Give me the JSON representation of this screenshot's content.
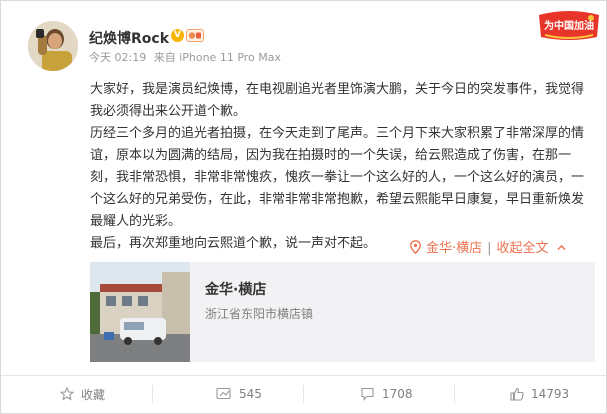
{
  "author": {
    "name": "纪焕博Rock",
    "verified_icon": "verified-v-icon",
    "level_icon": "member-level-icon"
  },
  "meta": {
    "time": "今天 02:19",
    "source": "来自 iPhone 11 Pro Max"
  },
  "promo": {
    "label": "为中国加油"
  },
  "post": {
    "paragraphs": [
      "大家好，我是演员纪焕博，在电视剧追光者里饰演大鹏，关于今日的突发事件，我觉得我必须得出来公开道个歉。",
      "历经三个多月的追光者拍摄，在今天走到了尾声。三个月下来大家积累了非常深厚的情谊，原本以为圆满的结局，因为我在拍摄时的一个失误，给云熙造成了伤害，在那一刻，我非常恐惧，非常非常愧疚，愧疚一拳让一个这么好的人，一个这么好的演员，一个这么好的兄弟受伤，在此，非常非常非常抱歉，希望云熙能早日康复，早日重新焕发最耀人的光彩。",
      "最后，再次郑重地向云熙道个歉，说一声对不起。"
    ],
    "location_label": "金华·横店",
    "expand_label": "收起全文",
    "expand_icon": "collapse-arrow-icon"
  },
  "location_card": {
    "title": "金华·横店",
    "address": "浙江省东阳市横店镇"
  },
  "actions": {
    "favorite": "收藏",
    "repost": "545",
    "comment": "1708",
    "like": "14793"
  },
  "colors": {
    "accent": "#eb7350",
    "text": "#333333",
    "muted": "#808080",
    "verified": "#f7b500"
  }
}
